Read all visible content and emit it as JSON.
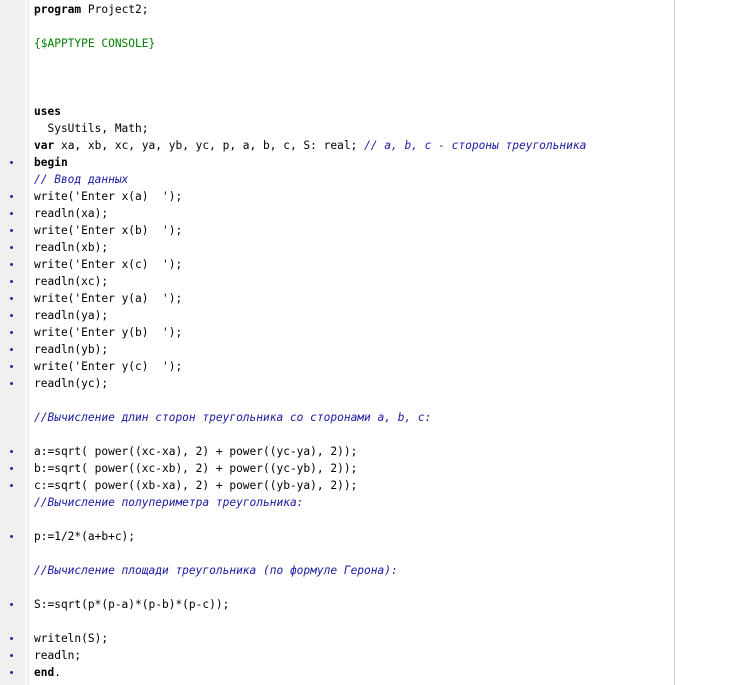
{
  "editor": {
    "colors": {
      "background": "#ffffff",
      "gutter": "#f0f0f0",
      "marker": "#1e2fa8",
      "comment": "#1a1aa0",
      "directive": "#008000",
      "text": "#000000"
    },
    "lines": [
      {
        "marker": false,
        "tokens": [
          {
            "t": "kw",
            "v": "program"
          },
          {
            "t": "plain",
            "v": " Project2;"
          }
        ]
      },
      {
        "marker": false,
        "tokens": []
      },
      {
        "marker": false,
        "tokens": [
          {
            "t": "dir",
            "v": "{$APPTYPE CONSOLE}"
          }
        ]
      },
      {
        "marker": false,
        "tokens": []
      },
      {
        "marker": false,
        "tokens": []
      },
      {
        "marker": false,
        "tokens": []
      },
      {
        "marker": false,
        "tokens": [
          {
            "t": "kw",
            "v": "uses"
          }
        ]
      },
      {
        "marker": false,
        "tokens": [
          {
            "t": "plain",
            "v": "  SysUtils, Math;"
          }
        ]
      },
      {
        "marker": false,
        "tokens": [
          {
            "t": "kw",
            "v": "var"
          },
          {
            "t": "plain",
            "v": " xa, xb, xc, ya, yb, yc, p, a, b, c, S: real; "
          },
          {
            "t": "cmt",
            "v": "// a, b, c - стороны треугольника"
          }
        ]
      },
      {
        "marker": true,
        "tokens": [
          {
            "t": "kw",
            "v": "begin"
          }
        ]
      },
      {
        "marker": false,
        "tokens": [
          {
            "t": "cmt",
            "v": "// Ввод данных"
          }
        ]
      },
      {
        "marker": true,
        "tokens": [
          {
            "t": "plain",
            "v": "write("
          },
          {
            "t": "str",
            "v": "'Enter x(a)  '"
          },
          {
            "t": "plain",
            "v": ");"
          }
        ]
      },
      {
        "marker": true,
        "tokens": [
          {
            "t": "plain",
            "v": "readln(xa);"
          }
        ]
      },
      {
        "marker": true,
        "tokens": [
          {
            "t": "plain",
            "v": "write("
          },
          {
            "t": "str",
            "v": "'Enter x(b)  '"
          },
          {
            "t": "plain",
            "v": ");"
          }
        ]
      },
      {
        "marker": true,
        "tokens": [
          {
            "t": "plain",
            "v": "readln(xb);"
          }
        ]
      },
      {
        "marker": true,
        "tokens": [
          {
            "t": "plain",
            "v": "write("
          },
          {
            "t": "str",
            "v": "'Enter x(c)  '"
          },
          {
            "t": "plain",
            "v": ");"
          }
        ]
      },
      {
        "marker": true,
        "tokens": [
          {
            "t": "plain",
            "v": "readln(xc);"
          }
        ]
      },
      {
        "marker": true,
        "tokens": [
          {
            "t": "plain",
            "v": "write("
          },
          {
            "t": "str",
            "v": "'Enter y(a)  '"
          },
          {
            "t": "plain",
            "v": ");"
          }
        ]
      },
      {
        "marker": true,
        "tokens": [
          {
            "t": "plain",
            "v": "readln(ya);"
          }
        ]
      },
      {
        "marker": true,
        "tokens": [
          {
            "t": "plain",
            "v": "write("
          },
          {
            "t": "str",
            "v": "'Enter y(b)  '"
          },
          {
            "t": "plain",
            "v": ");"
          }
        ]
      },
      {
        "marker": true,
        "tokens": [
          {
            "t": "plain",
            "v": "readln(yb);"
          }
        ]
      },
      {
        "marker": true,
        "tokens": [
          {
            "t": "plain",
            "v": "write("
          },
          {
            "t": "str",
            "v": "'Enter y(c)  '"
          },
          {
            "t": "plain",
            "v": ");"
          }
        ]
      },
      {
        "marker": true,
        "tokens": [
          {
            "t": "plain",
            "v": "readln(yc);"
          }
        ]
      },
      {
        "marker": false,
        "tokens": []
      },
      {
        "marker": false,
        "tokens": [
          {
            "t": "cmt",
            "v": "//Вычисление длин сторон треугольника со сторонами a, b, c:"
          }
        ]
      },
      {
        "marker": false,
        "tokens": []
      },
      {
        "marker": true,
        "tokens": [
          {
            "t": "plain",
            "v": "a:=sqrt( power((xc-xa), 2) + power((yc-ya), 2));"
          }
        ]
      },
      {
        "marker": true,
        "tokens": [
          {
            "t": "plain",
            "v": "b:=sqrt( power((xc-xb), 2) + power((yc-yb), 2));"
          }
        ]
      },
      {
        "marker": true,
        "tokens": [
          {
            "t": "plain",
            "v": "c:=sqrt( power((xb-xa), 2) + power((yb-ya), 2));"
          }
        ]
      },
      {
        "marker": false,
        "tokens": [
          {
            "t": "cmt",
            "v": "//Вычисление полупериметра треугольника:"
          }
        ]
      },
      {
        "marker": false,
        "tokens": []
      },
      {
        "marker": true,
        "tokens": [
          {
            "t": "plain",
            "v": "p:=1/2*(a+b+c);"
          }
        ]
      },
      {
        "marker": false,
        "tokens": []
      },
      {
        "marker": false,
        "tokens": [
          {
            "t": "cmt",
            "v": "//Вычисление площади треугольника (по формуле Герона):"
          }
        ]
      },
      {
        "marker": false,
        "tokens": []
      },
      {
        "marker": true,
        "tokens": [
          {
            "t": "plain",
            "v": "S:=sqrt(p*(p-a)*(p-b)*(p-c));"
          }
        ]
      },
      {
        "marker": false,
        "tokens": []
      },
      {
        "marker": true,
        "tokens": [
          {
            "t": "plain",
            "v": "writeln(S);"
          }
        ]
      },
      {
        "marker": true,
        "tokens": [
          {
            "t": "plain",
            "v": "readln;"
          }
        ]
      },
      {
        "marker": true,
        "tokens": [
          {
            "t": "kw",
            "v": "end"
          },
          {
            "t": "plain",
            "v": "."
          }
        ]
      }
    ]
  }
}
